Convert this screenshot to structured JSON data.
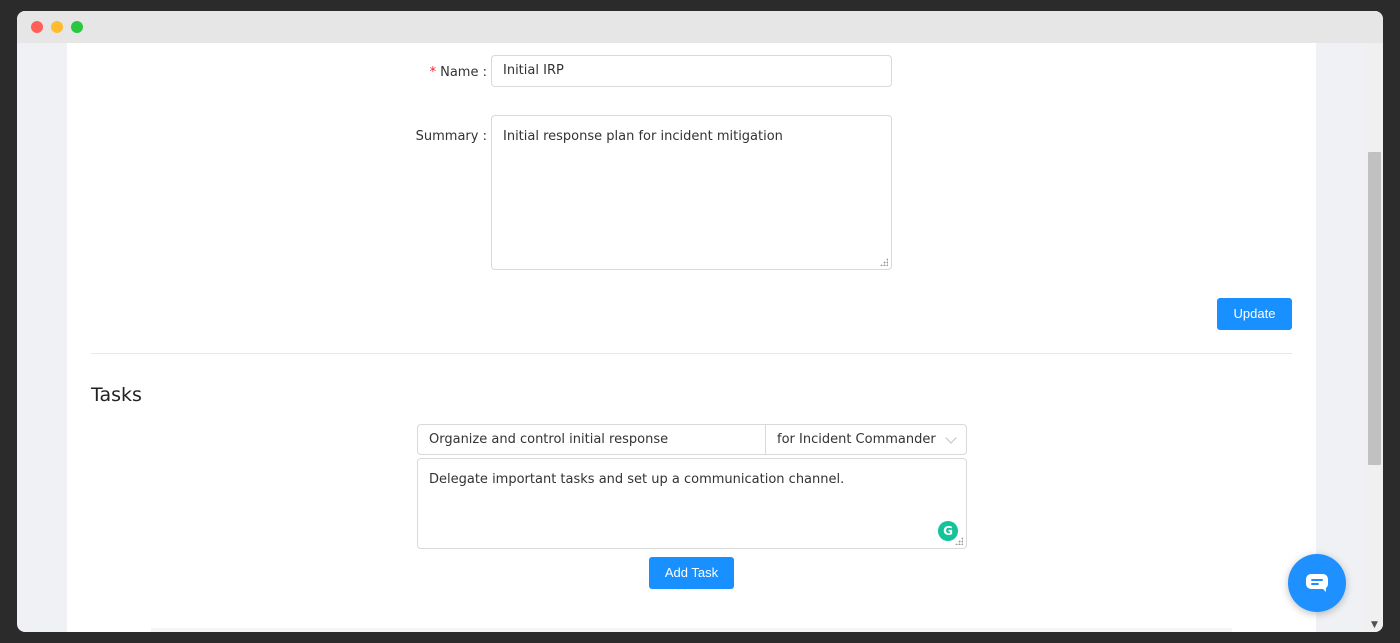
{
  "form": {
    "name_label": "Name",
    "required_mark": "*",
    "name_value": "Initial IRP",
    "summary_label": "Summary",
    "summary_value": "Initial response plan for incident mitigation",
    "label_suffix": ":",
    "update_label": "Update"
  },
  "tasks": {
    "title": "Tasks",
    "task_name_value": "Organize and control initial response",
    "role_selected": "for Incident Commander",
    "task_description_value": "Delegate important tasks and set up a communication channel.",
    "grammarly_letter": "G",
    "add_task_label": "Add Task"
  },
  "colors": {
    "primary": "#1890ff",
    "required": "#f5222d",
    "grammarly": "#15c39a"
  },
  "icons": {
    "select_arrow": "chevron-down-icon",
    "chat": "chat-icon",
    "grammarly": "grammarly-icon"
  }
}
